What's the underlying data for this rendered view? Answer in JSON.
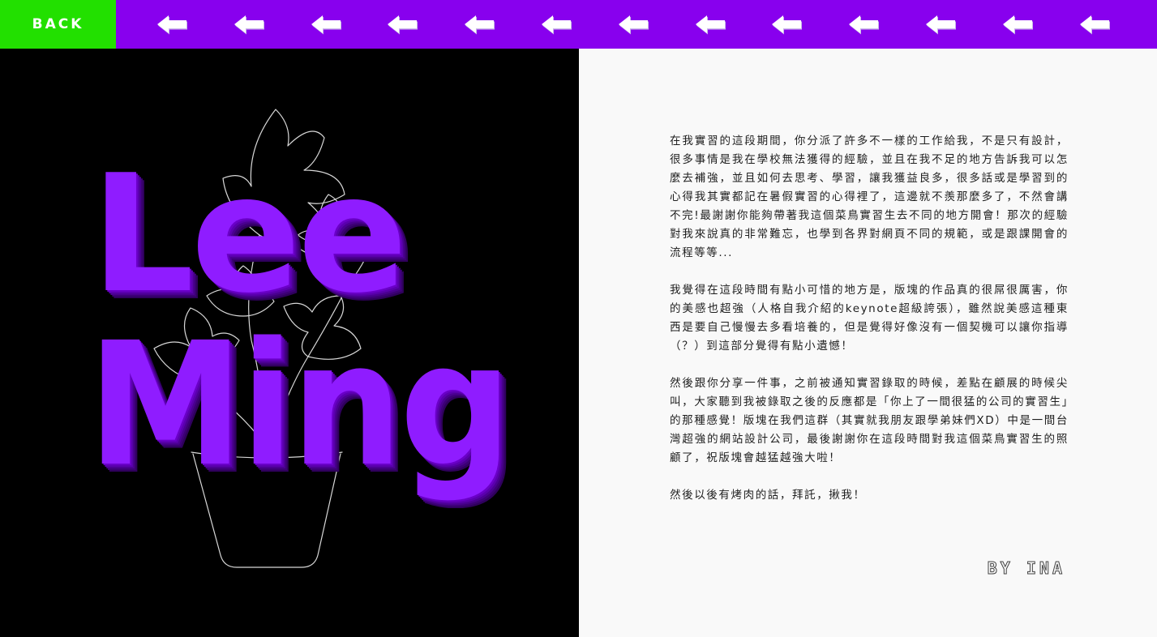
{
  "topbar": {
    "back_label": "BACK",
    "arrow_icon": "left-arrow-icon",
    "arrow_count": 13,
    "colors": {
      "bar": "#8800ee",
      "back": "#22e000",
      "arrow": "#ffffff"
    }
  },
  "hero": {
    "name_line_1": "Lee",
    "name_line_2": "Ming",
    "text_color": "#8f1cff",
    "background": "#000000",
    "illustration": "potted-plant-outline"
  },
  "letter": {
    "paragraphs": [
      "在我實習的這段期間，你分派了許多不一樣的工作給我，不是只有設計，很多事情是我在學校無法獲得的經驗，並且在我不足的地方告訴我可以怎麼去補強，並且如何去思考、學習，讓我獲益良多，很多話或是學習到的心得我其實都記在暑假實習的心得裡了，這邊就不羨那麼多了，不然會講不完!最謝謝你能夠帶著我這個菜鳥實習生去不同的地方開會！那次的經驗對我來說真的非常難忘，也學到各界對網頁不同的規範，或是跟課開會的流程等等...",
      "我覺得在這段時間有點小可惜的地方是，版塊的作品真的很屌很厲害，你的美感也超強（人格自我介紹的keynote超級誇張），雖然說美感這種東西是要自己慢慢去多看培養的，但是覺得好像沒有一個契機可以讓你指導（？）到這部分覺得有點小遺憾！",
      "然後跟你分享一件事，之前被通知實習錄取的時候，差點在顧展的時候尖叫，大家聽到我被錄取之後的反應都是「你上了一間很猛的公司的實習生」的那種感覺！版塊在我們這群（其實就我朋友跟學弟妹們XD）中是一間台灣超強的網站設計公司，最後謝謝你在這段時間對我這個菜鳥實習生的照顧了，祝版塊會越猛越強大啦！",
      "然後以後有烤肉的話，拜託，揪我！"
    ],
    "signature": "BY INA"
  }
}
